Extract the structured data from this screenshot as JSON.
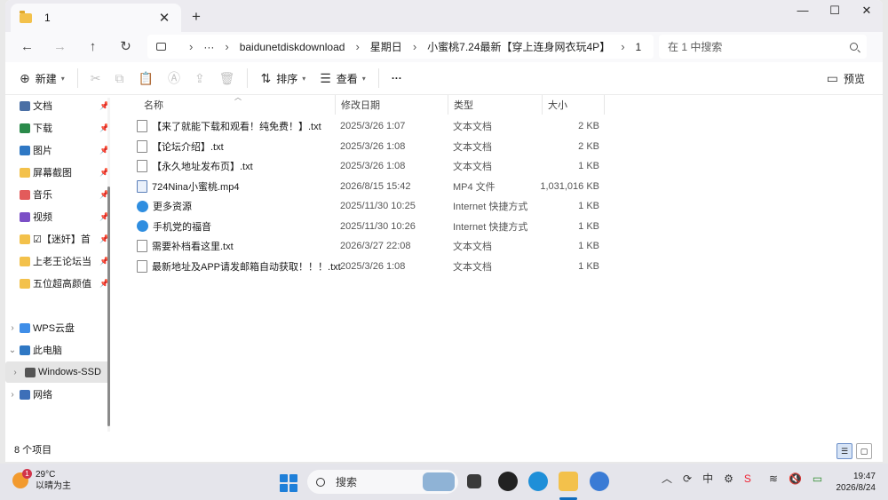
{
  "window": {
    "tab_title": "1",
    "tab_close": "✕",
    "new_tab": "+",
    "minimize": "—",
    "maximize": "☐",
    "close": "✕"
  },
  "nav": {
    "back": "←",
    "forward": "→",
    "up": "↑",
    "refresh": "↻",
    "breadcrumbs": [
      "baidunetdiskdownload",
      "星期日",
      "小蜜桃7.24最新【穿上连身网衣玩4P】",
      "1"
    ],
    "more": "···",
    "search_placeholder": "在 1 中搜索"
  },
  "toolbar": {
    "new_label": "新建",
    "sort_label": "排序",
    "view_label": "查看",
    "more": "···",
    "preview_label": "预览"
  },
  "sidebar": {
    "items": [
      {
        "label": "文档",
        "icon": "document-icon",
        "color": "#4a6fa5",
        "pinned": true
      },
      {
        "label": "下载",
        "icon": "download-icon",
        "color": "#2a8a4a",
        "pinned": true
      },
      {
        "label": "图片",
        "icon": "picture-icon",
        "color": "#2f78c4",
        "pinned": true
      },
      {
        "label": "屏幕截图",
        "icon": "folder-icon",
        "color": "#f3c14b",
        "pinned": true
      },
      {
        "label": "音乐",
        "icon": "music-icon",
        "color": "#e35b5b",
        "pinned": true
      },
      {
        "label": "视频",
        "icon": "video-icon",
        "color": "#7b4fc6",
        "pinned": true
      },
      {
        "label": "☑【迷奸】首",
        "icon": "folder-icon",
        "color": "#f3c14b",
        "pinned": true
      },
      {
        "label": "上老王论坛当",
        "icon": "folder-icon",
        "color": "#f3c14b",
        "pinned": true
      },
      {
        "label": "五位超高颜值",
        "icon": "folder-icon",
        "color": "#f3c14b",
        "pinned": true
      }
    ],
    "tree": [
      {
        "label": "WPS云盘",
        "icon": "cloud-icon",
        "expand": "›"
      },
      {
        "label": "此电脑",
        "icon": "computer-icon",
        "expand": "⌄"
      },
      {
        "label": "Windows-SSD",
        "icon": "drive-icon",
        "expand": "›"
      },
      {
        "label": "网络",
        "icon": "network-icon",
        "expand": "›"
      }
    ]
  },
  "columns": {
    "name": "名称",
    "modified": "修改日期",
    "type": "类型",
    "size": "大小"
  },
  "files": [
    {
      "name": "【来了就能下载和观看！纯免费！】.txt",
      "modified": "2025/3/26 1:07",
      "type": "文本文档",
      "size": "2 KB",
      "icon": "text-file-icon"
    },
    {
      "name": "【论坛介绍】.txt",
      "modified": "2025/3/26 1:08",
      "type": "文本文档",
      "size": "2 KB",
      "icon": "text-file-icon"
    },
    {
      "name": "【永久地址发布页】.txt",
      "modified": "2025/3/26 1:08",
      "type": "文本文档",
      "size": "1 KB",
      "icon": "text-file-icon"
    },
    {
      "name": "724Nina小蜜桃.mp4",
      "modified": "2026/8/15 15:42",
      "type": "MP4 文件",
      "size": "1,031,016 KB",
      "icon": "video-file-icon"
    },
    {
      "name": "更多资源",
      "modified": "2025/11/30 10:25",
      "type": "Internet 快捷方式",
      "size": "1 KB",
      "icon": "internet-shortcut-icon"
    },
    {
      "name": "手机党的福音",
      "modified": "2025/11/30 10:26",
      "type": "Internet 快捷方式",
      "size": "1 KB",
      "icon": "internet-shortcut-icon"
    },
    {
      "name": "需要补档看这里.txt",
      "modified": "2026/3/27 22:08",
      "type": "文本文档",
      "size": "1 KB",
      "icon": "text-file-icon"
    },
    {
      "name": "最新地址及APP请发邮箱自动获取！！！.txt",
      "modified": "2025/3/26 1:08",
      "type": "文本文档",
      "size": "1 KB",
      "icon": "text-file-icon"
    }
  ],
  "status": {
    "item_count": "8 个项目"
  },
  "taskbar": {
    "temperature": "29°C",
    "weather": "以晴为主",
    "weather_badge": "1",
    "search_label": "搜索",
    "ime": "中",
    "time": "19:47",
    "date": "2026/8/24"
  }
}
